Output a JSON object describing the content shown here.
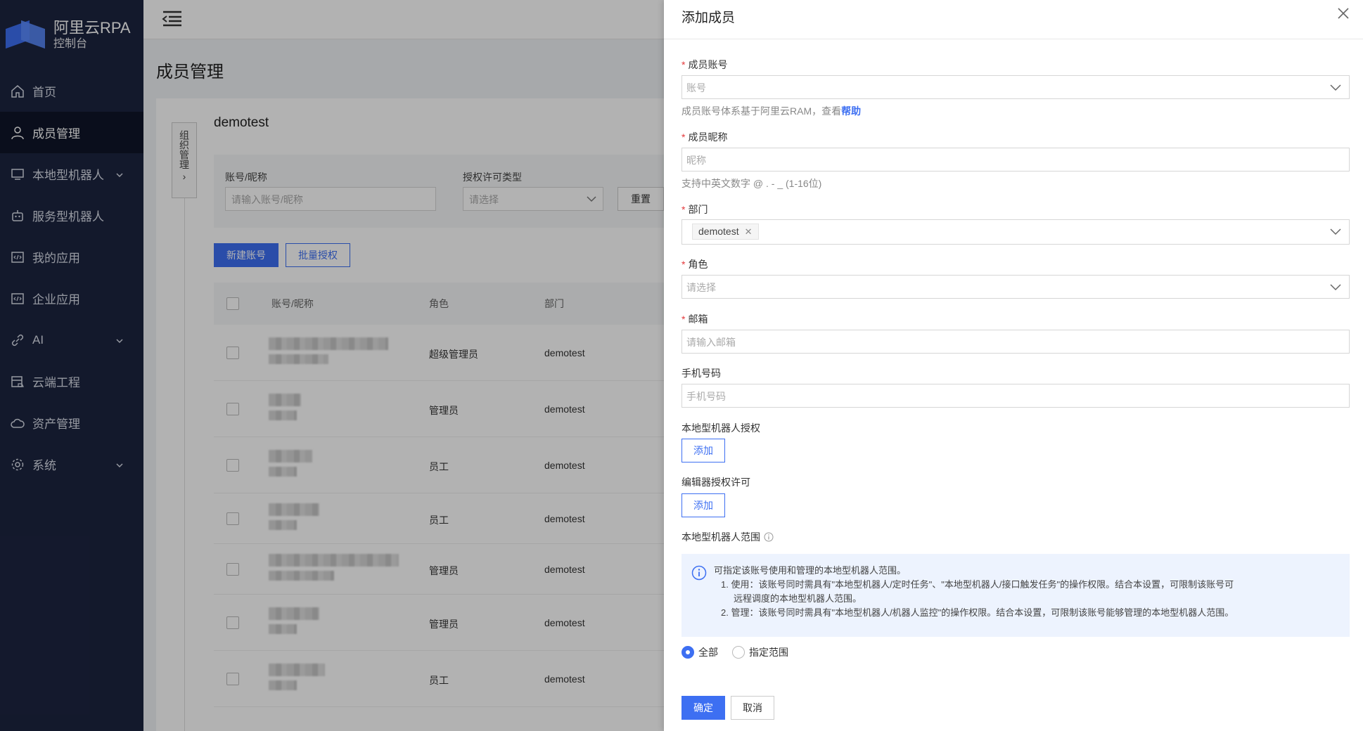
{
  "app": {
    "title_line1": "阿里云RPA",
    "title_line2": "控制台"
  },
  "sidebar": {
    "items": [
      {
        "label": "首页",
        "icon": "home-icon"
      },
      {
        "label": "成员管理",
        "icon": "user-icon",
        "active": true
      },
      {
        "label": "本地型机器人",
        "icon": "monitor-icon",
        "expandable": true
      },
      {
        "label": "服务型机器人",
        "icon": "robot-icon"
      },
      {
        "label": "我的应用",
        "icon": "code-icon"
      },
      {
        "label": "企业应用",
        "icon": "code-icon"
      },
      {
        "label": "AI",
        "icon": "link-icon",
        "expandable": true
      },
      {
        "label": "云端工程",
        "icon": "cloud-project-icon"
      },
      {
        "label": "资产管理",
        "icon": "cloud-icon"
      },
      {
        "label": "系统",
        "icon": "gear-icon",
        "expandable": true
      }
    ]
  },
  "main": {
    "page_title": "成员管理",
    "org_tab": "组织管理",
    "department": "demotest",
    "filters": {
      "account_label": "账号/昵称",
      "account_placeholder": "请输入账号/昵称",
      "license_label": "授权许可类型",
      "license_placeholder": "请选择",
      "reset": "重置"
    },
    "actions": {
      "new_account": "新建账号",
      "batch_auth": "批量授权"
    },
    "table": {
      "headers": [
        "账号/昵称",
        "角色",
        "部门"
      ],
      "rows": [
        {
          "role": "超级管理员",
          "dept": "demotest"
        },
        {
          "role": "管理员",
          "dept": "demotest"
        },
        {
          "role": "员工",
          "dept": "demotest"
        },
        {
          "role": "员工",
          "dept": "demotest"
        },
        {
          "role": "管理员",
          "dept": "demotest"
        },
        {
          "role": "管理员",
          "dept": "demotest"
        },
        {
          "role": "员工",
          "dept": "demotest"
        }
      ]
    }
  },
  "drawer": {
    "title": "添加成员",
    "account": {
      "label": "成员账号",
      "placeholder": "账号",
      "hint": "成员账号体系基于阿里云RAM，查看",
      "hint_link": "帮助"
    },
    "nickname": {
      "label": "成员昵称",
      "placeholder": "昵称",
      "hint": "支持中英文数字 @ . - _ (1-16位)"
    },
    "department": {
      "label": "部门",
      "tag": "demotest"
    },
    "role": {
      "label": "角色",
      "placeholder": "请选择"
    },
    "email": {
      "label": "邮箱",
      "placeholder": "请输入邮箱"
    },
    "phone": {
      "label": "手机号码",
      "placeholder": "手机号码"
    },
    "robot_auth": {
      "label": "本地型机器人授权",
      "button": "添加"
    },
    "editor_auth": {
      "label": "编辑器授权许可",
      "button": "添加"
    },
    "robot_scope": {
      "label": "本地型机器人范围",
      "info_title": "可指定该账号使用和管理的本地型机器人范围。",
      "info_1": "1. 使用：该账号同时需具有\"本地型机器人/定时任务\"、\"本地型机器人/接口触发任务\"的操作权限。结合本设置，可限制该账号可",
      "info_1b": "远程调度的本地型机器人范围。",
      "info_2": "2. 管理：该账号同时需具有\"本地型机器人/机器人监控\"的操作权限。结合本设置，可限制该账号能够管理的本地型机器人范围。",
      "option_all": "全部",
      "option_specified": "指定范围",
      "selected": "全部"
    },
    "confirm": "确定",
    "cancel": "取消"
  }
}
